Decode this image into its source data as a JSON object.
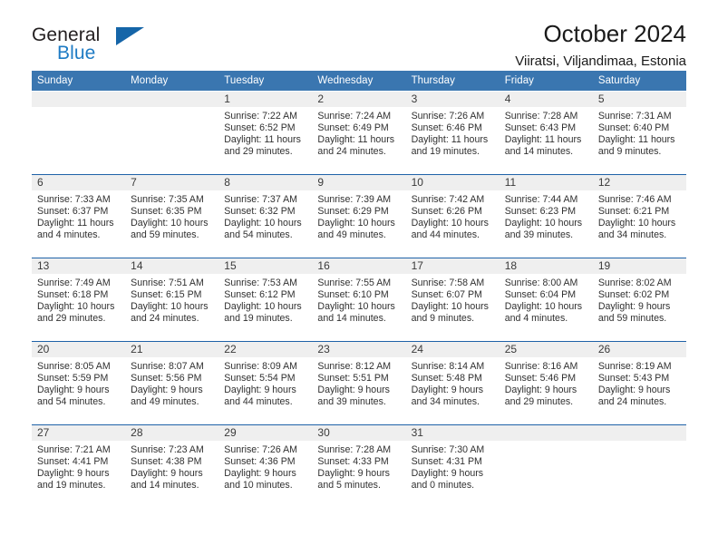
{
  "brand": {
    "name_top": "General",
    "name_bottom": "Blue",
    "triangle_color": "#1565a8",
    "text_color": "#231f20",
    "blue_color": "#1e7bc4"
  },
  "header": {
    "title": "October 2024",
    "subtitle": "Viiratsi, Viljandimaa, Estonia"
  },
  "theme": {
    "header_blue": "#3a76b0",
    "row_border_blue": "#1f62a8",
    "daynum_band": "#efefef"
  },
  "weekday_headers": [
    "Sunday",
    "Monday",
    "Tuesday",
    "Wednesday",
    "Thursday",
    "Friday",
    "Saturday"
  ],
  "weeks": [
    [
      {
        "day": "",
        "sunrise": "",
        "sunset": "",
        "daylight_line1": "",
        "daylight_line2": "",
        "empty": true
      },
      {
        "day": "",
        "sunrise": "",
        "sunset": "",
        "daylight_line1": "",
        "daylight_line2": "",
        "empty": true
      },
      {
        "day": "1",
        "sunrise": "Sunrise: 7:22 AM",
        "sunset": "Sunset: 6:52 PM",
        "daylight_line1": "Daylight: 11 hours",
        "daylight_line2": "and 29 minutes."
      },
      {
        "day": "2",
        "sunrise": "Sunrise: 7:24 AM",
        "sunset": "Sunset: 6:49 PM",
        "daylight_line1": "Daylight: 11 hours",
        "daylight_line2": "and 24 minutes."
      },
      {
        "day": "3",
        "sunrise": "Sunrise: 7:26 AM",
        "sunset": "Sunset: 6:46 PM",
        "daylight_line1": "Daylight: 11 hours",
        "daylight_line2": "and 19 minutes."
      },
      {
        "day": "4",
        "sunrise": "Sunrise: 7:28 AM",
        "sunset": "Sunset: 6:43 PM",
        "daylight_line1": "Daylight: 11 hours",
        "daylight_line2": "and 14 minutes."
      },
      {
        "day": "5",
        "sunrise": "Sunrise: 7:31 AM",
        "sunset": "Sunset: 6:40 PM",
        "daylight_line1": "Daylight: 11 hours",
        "daylight_line2": "and 9 minutes."
      }
    ],
    [
      {
        "day": "6",
        "sunrise": "Sunrise: 7:33 AM",
        "sunset": "Sunset: 6:37 PM",
        "daylight_line1": "Daylight: 11 hours",
        "daylight_line2": "and 4 minutes."
      },
      {
        "day": "7",
        "sunrise": "Sunrise: 7:35 AM",
        "sunset": "Sunset: 6:35 PM",
        "daylight_line1": "Daylight: 10 hours",
        "daylight_line2": "and 59 minutes."
      },
      {
        "day": "8",
        "sunrise": "Sunrise: 7:37 AM",
        "sunset": "Sunset: 6:32 PM",
        "daylight_line1": "Daylight: 10 hours",
        "daylight_line2": "and 54 minutes."
      },
      {
        "day": "9",
        "sunrise": "Sunrise: 7:39 AM",
        "sunset": "Sunset: 6:29 PM",
        "daylight_line1": "Daylight: 10 hours",
        "daylight_line2": "and 49 minutes."
      },
      {
        "day": "10",
        "sunrise": "Sunrise: 7:42 AM",
        "sunset": "Sunset: 6:26 PM",
        "daylight_line1": "Daylight: 10 hours",
        "daylight_line2": "and 44 minutes."
      },
      {
        "day": "11",
        "sunrise": "Sunrise: 7:44 AM",
        "sunset": "Sunset: 6:23 PM",
        "daylight_line1": "Daylight: 10 hours",
        "daylight_line2": "and 39 minutes."
      },
      {
        "day": "12",
        "sunrise": "Sunrise: 7:46 AM",
        "sunset": "Sunset: 6:21 PM",
        "daylight_line1": "Daylight: 10 hours",
        "daylight_line2": "and 34 minutes."
      }
    ],
    [
      {
        "day": "13",
        "sunrise": "Sunrise: 7:49 AM",
        "sunset": "Sunset: 6:18 PM",
        "daylight_line1": "Daylight: 10 hours",
        "daylight_line2": "and 29 minutes."
      },
      {
        "day": "14",
        "sunrise": "Sunrise: 7:51 AM",
        "sunset": "Sunset: 6:15 PM",
        "daylight_line1": "Daylight: 10 hours",
        "daylight_line2": "and 24 minutes."
      },
      {
        "day": "15",
        "sunrise": "Sunrise: 7:53 AM",
        "sunset": "Sunset: 6:12 PM",
        "daylight_line1": "Daylight: 10 hours",
        "daylight_line2": "and 19 minutes."
      },
      {
        "day": "16",
        "sunrise": "Sunrise: 7:55 AM",
        "sunset": "Sunset: 6:10 PM",
        "daylight_line1": "Daylight: 10 hours",
        "daylight_line2": "and 14 minutes."
      },
      {
        "day": "17",
        "sunrise": "Sunrise: 7:58 AM",
        "sunset": "Sunset: 6:07 PM",
        "daylight_line1": "Daylight: 10 hours",
        "daylight_line2": "and 9 minutes."
      },
      {
        "day": "18",
        "sunrise": "Sunrise: 8:00 AM",
        "sunset": "Sunset: 6:04 PM",
        "daylight_line1": "Daylight: 10 hours",
        "daylight_line2": "and 4 minutes."
      },
      {
        "day": "19",
        "sunrise": "Sunrise: 8:02 AM",
        "sunset": "Sunset: 6:02 PM",
        "daylight_line1": "Daylight: 9 hours",
        "daylight_line2": "and 59 minutes."
      }
    ],
    [
      {
        "day": "20",
        "sunrise": "Sunrise: 8:05 AM",
        "sunset": "Sunset: 5:59 PM",
        "daylight_line1": "Daylight: 9 hours",
        "daylight_line2": "and 54 minutes."
      },
      {
        "day": "21",
        "sunrise": "Sunrise: 8:07 AM",
        "sunset": "Sunset: 5:56 PM",
        "daylight_line1": "Daylight: 9 hours",
        "daylight_line2": "and 49 minutes."
      },
      {
        "day": "22",
        "sunrise": "Sunrise: 8:09 AM",
        "sunset": "Sunset: 5:54 PM",
        "daylight_line1": "Daylight: 9 hours",
        "daylight_line2": "and 44 minutes."
      },
      {
        "day": "23",
        "sunrise": "Sunrise: 8:12 AM",
        "sunset": "Sunset: 5:51 PM",
        "daylight_line1": "Daylight: 9 hours",
        "daylight_line2": "and 39 minutes."
      },
      {
        "day": "24",
        "sunrise": "Sunrise: 8:14 AM",
        "sunset": "Sunset: 5:48 PM",
        "daylight_line1": "Daylight: 9 hours",
        "daylight_line2": "and 34 minutes."
      },
      {
        "day": "25",
        "sunrise": "Sunrise: 8:16 AM",
        "sunset": "Sunset: 5:46 PM",
        "daylight_line1": "Daylight: 9 hours",
        "daylight_line2": "and 29 minutes."
      },
      {
        "day": "26",
        "sunrise": "Sunrise: 8:19 AM",
        "sunset": "Sunset: 5:43 PM",
        "daylight_line1": "Daylight: 9 hours",
        "daylight_line2": "and 24 minutes."
      }
    ],
    [
      {
        "day": "27",
        "sunrise": "Sunrise: 7:21 AM",
        "sunset": "Sunset: 4:41 PM",
        "daylight_line1": "Daylight: 9 hours",
        "daylight_line2": "and 19 minutes."
      },
      {
        "day": "28",
        "sunrise": "Sunrise: 7:23 AM",
        "sunset": "Sunset: 4:38 PM",
        "daylight_line1": "Daylight: 9 hours",
        "daylight_line2": "and 14 minutes."
      },
      {
        "day": "29",
        "sunrise": "Sunrise: 7:26 AM",
        "sunset": "Sunset: 4:36 PM",
        "daylight_line1": "Daylight: 9 hours",
        "daylight_line2": "and 10 minutes."
      },
      {
        "day": "30",
        "sunrise": "Sunrise: 7:28 AM",
        "sunset": "Sunset: 4:33 PM",
        "daylight_line1": "Daylight: 9 hours",
        "daylight_line2": "and 5 minutes."
      },
      {
        "day": "31",
        "sunrise": "Sunrise: 7:30 AM",
        "sunset": "Sunset: 4:31 PM",
        "daylight_line1": "Daylight: 9 hours",
        "daylight_line2": "and 0 minutes."
      },
      {
        "day": "",
        "sunrise": "",
        "sunset": "",
        "daylight_line1": "",
        "daylight_line2": "",
        "empty": true
      },
      {
        "day": "",
        "sunrise": "",
        "sunset": "",
        "daylight_line1": "",
        "daylight_line2": "",
        "empty": true
      }
    ]
  ]
}
